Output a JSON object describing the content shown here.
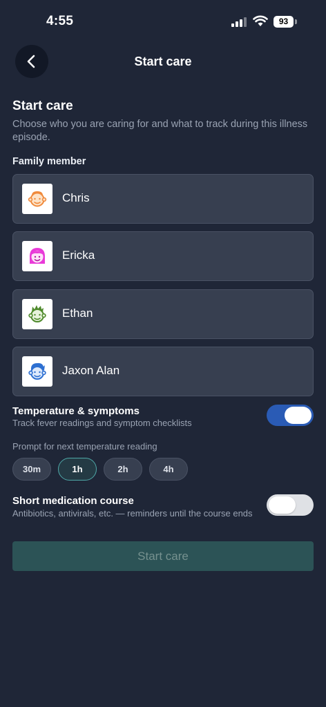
{
  "status_bar": {
    "time": "4:55",
    "battery": "93"
  },
  "header": {
    "title": "Start care"
  },
  "intro": {
    "title": "Start care",
    "description": "Choose who you are caring for and what to track during this illness episode."
  },
  "family": {
    "label": "Family member",
    "members": [
      {
        "name": "Chris",
        "avatar_icon": "boy-face-icon",
        "color": "#f08a3c"
      },
      {
        "name": "Ericka",
        "avatar_icon": "girl-face-icon",
        "color": "#e93ad8"
      },
      {
        "name": "Ethan",
        "avatar_icon": "boy-face-icon",
        "color": "#4f8a2c"
      },
      {
        "name": "Jaxon Alan",
        "avatar_icon": "boy-face-icon",
        "color": "#2d6fd1"
      }
    ]
  },
  "temperature": {
    "title": "Temperature & symptoms",
    "subtitle": "Track fever readings and symptom checklists",
    "enabled": true
  },
  "prompt": {
    "label": "Prompt for next temperature reading",
    "options": [
      "30m",
      "1h",
      "2h",
      "4h"
    ],
    "selected": "1h"
  },
  "medication": {
    "title": "Short medication course",
    "subtitle": "Antibiotics, antivirals, etc. — reminders until the course ends",
    "enabled": false
  },
  "actions": {
    "start_label": "Start care"
  },
  "colors": {
    "background": "#1f2637",
    "card": "#373f50",
    "accent": "#2a5bb5",
    "selected_chip_border": "#4fa8a8",
    "primary_button": "#2c5356"
  }
}
